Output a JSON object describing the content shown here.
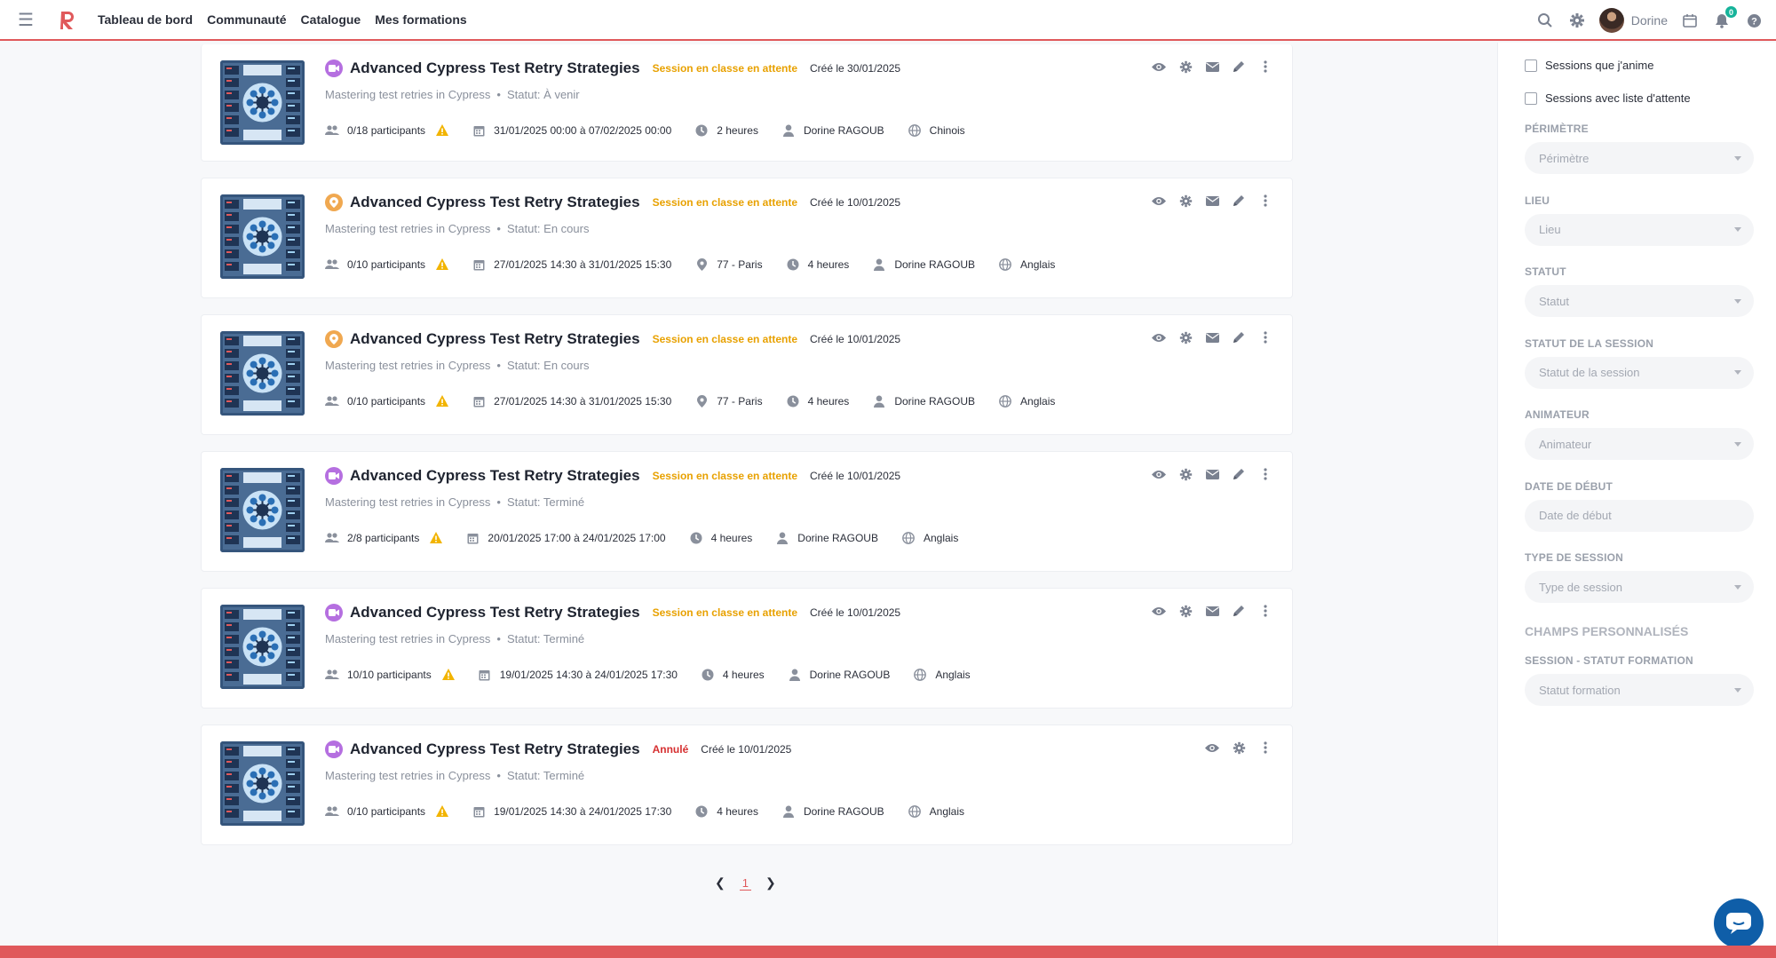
{
  "topbar": {
    "nav": [
      "Tableau de bord",
      "Communauté",
      "Catalogue",
      "Mes formations"
    ],
    "user_name": "Dorine",
    "notif_count": "0"
  },
  "colors": {
    "accent": "#e0595b",
    "status_pending": "#e8a100",
    "status_cancelled": "#d63031",
    "virtual_badge": "#b56fe0",
    "presential_badge": "#f0a850",
    "warning": "#f2b400"
  },
  "sessions": [
    {
      "type_icon": "video-icon",
      "title": "Advanced Cypress Test Retry Strategies",
      "status": "Session en classe en attente",
      "status_kind": "pending",
      "created": "Créé le 30/01/2025",
      "subtitle": "Mastering test retries in Cypress",
      "state": "Statut: À venir",
      "participants": "0/18 participants",
      "dates": "31/01/2025 00:00 à 07/02/2025 00:00",
      "location": "",
      "duration": "2 heures",
      "trainer": "Dorine RAGOUB",
      "language": "Chinois",
      "actions": [
        "eye",
        "gear",
        "mail",
        "pencil",
        "more"
      ]
    },
    {
      "type_icon": "location-pin-icon",
      "title": "Advanced Cypress Test Retry Strategies",
      "status": "Session en classe en attente",
      "status_kind": "pending",
      "created": "Créé le 10/01/2025",
      "subtitle": "Mastering test retries in Cypress",
      "state": "Statut: En cours",
      "participants": "0/10 participants",
      "dates": "27/01/2025 14:30 à 31/01/2025 15:30",
      "location": "77 - Paris",
      "duration": "4 heures",
      "trainer": "Dorine RAGOUB",
      "language": "Anglais",
      "actions": [
        "eye",
        "gear",
        "mail",
        "pencil",
        "more"
      ]
    },
    {
      "type_icon": "location-pin-icon",
      "title": "Advanced Cypress Test Retry Strategies",
      "status": "Session en classe en attente",
      "status_kind": "pending",
      "created": "Créé le 10/01/2025",
      "subtitle": "Mastering test retries in Cypress",
      "state": "Statut: En cours",
      "participants": "0/10 participants",
      "dates": "27/01/2025 14:30 à 31/01/2025 15:30",
      "location": "77 - Paris",
      "duration": "4 heures",
      "trainer": "Dorine RAGOUB",
      "language": "Anglais",
      "actions": [
        "eye",
        "gear",
        "mail",
        "pencil",
        "more"
      ]
    },
    {
      "type_icon": "video-icon",
      "title": "Advanced Cypress Test Retry Strategies",
      "status": "Session en classe en attente",
      "status_kind": "pending",
      "created": "Créé le 10/01/2025",
      "subtitle": "Mastering test retries in Cypress",
      "state": "Statut: Terminé",
      "participants": "2/8 participants",
      "dates": "20/01/2025 17:00 à 24/01/2025 17:00",
      "location": "",
      "duration": "4 heures",
      "trainer": "Dorine RAGOUB",
      "language": "Anglais",
      "actions": [
        "eye",
        "gear",
        "mail",
        "pencil",
        "more"
      ]
    },
    {
      "type_icon": "video-icon",
      "title": "Advanced Cypress Test Retry Strategies",
      "status": "Session en classe en attente",
      "status_kind": "pending",
      "created": "Créé le 10/01/2025",
      "subtitle": "Mastering test retries in Cypress",
      "state": "Statut: Terminé",
      "participants": "10/10 participants",
      "dates": "19/01/2025 14:30 à 24/01/2025 17:30",
      "location": "",
      "duration": "4 heures",
      "trainer": "Dorine RAGOUB",
      "language": "Anglais",
      "actions": [
        "eye",
        "gear",
        "mail",
        "pencil",
        "more"
      ]
    },
    {
      "type_icon": "video-icon",
      "title": "Advanced Cypress Test Retry Strategies",
      "status": "Annulé",
      "status_kind": "cancelled",
      "created": "Créé le 10/01/2025",
      "subtitle": "Mastering test retries in Cypress",
      "state": "Statut: Terminé",
      "participants": "0/10 participants",
      "dates": "19/01/2025 14:30 à 24/01/2025 17:30",
      "location": "",
      "duration": "4 heures",
      "trainer": "Dorine RAGOUB",
      "language": "Anglais",
      "actions": [
        "eye",
        "gear",
        "more"
      ]
    }
  ],
  "pagination": {
    "current": "1"
  },
  "filters": {
    "checkboxes": [
      "Sessions que j'anime",
      "Sessions avec liste d'attente"
    ],
    "fields": [
      {
        "label": "Périmètre",
        "placeholder": "Périmètre",
        "kind": "select"
      },
      {
        "label": "Lieu",
        "placeholder": "Lieu",
        "kind": "select"
      },
      {
        "label": "Statut",
        "placeholder": "Statut",
        "kind": "select"
      },
      {
        "label": "Statut de la session",
        "placeholder": "Statut de la session",
        "kind": "select"
      },
      {
        "label": "Animateur",
        "placeholder": "Animateur",
        "kind": "select"
      },
      {
        "label": "Date de début",
        "placeholder": "Date de début",
        "kind": "input"
      },
      {
        "label": "Type de session",
        "placeholder": "Type de session",
        "kind": "select"
      }
    ],
    "custom_title": "Champs personnalisés",
    "custom_fields": [
      {
        "label": "Session - Statut formation",
        "placeholder": "Statut formation",
        "kind": "select"
      }
    ]
  }
}
